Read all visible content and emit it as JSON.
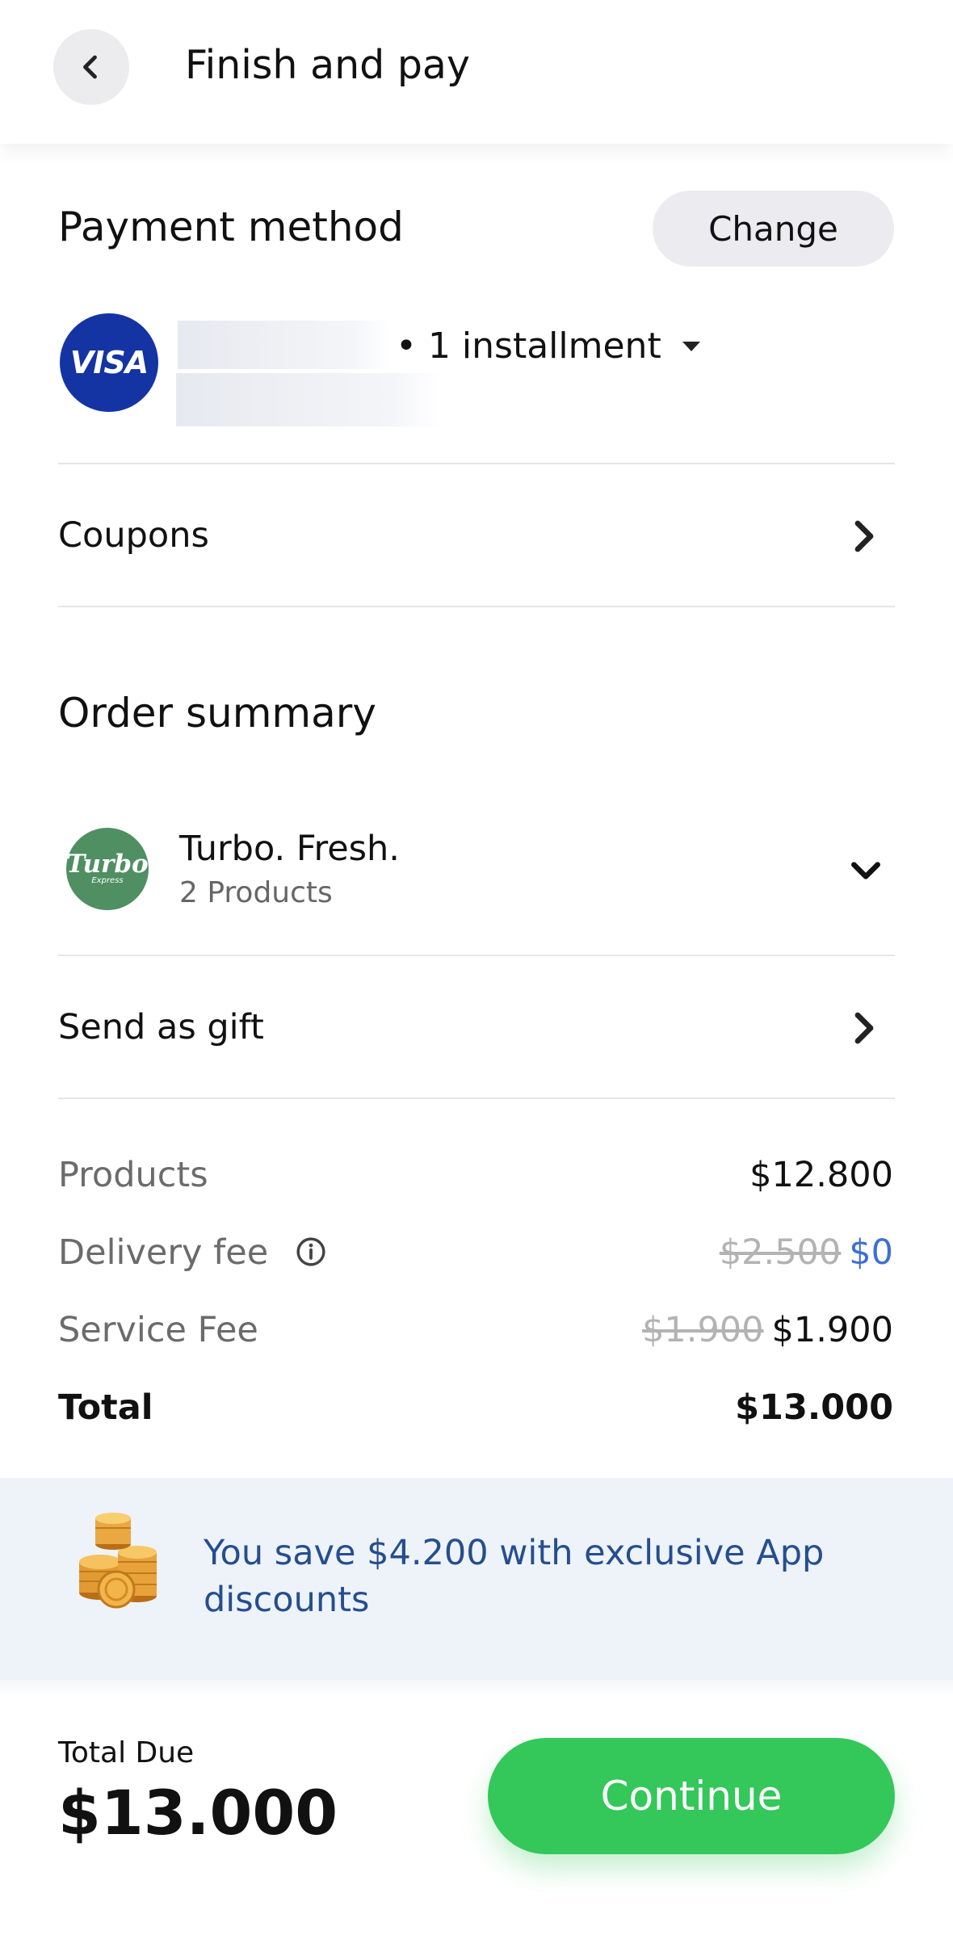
{
  "header": {
    "title": "Finish and pay"
  },
  "payment": {
    "title": "Payment method",
    "change_label": "Change",
    "card_brand": "VISA",
    "installment": "• 1 installment"
  },
  "coupons": {
    "label": "Coupons"
  },
  "order": {
    "title": "Order summary",
    "store": {
      "name": "Turbo. Fresh.",
      "products": "2 Products",
      "logo_text": "Turbo",
      "logo_subtext": "Express"
    }
  },
  "gift": {
    "label": "Send as gift"
  },
  "summary": {
    "products": {
      "label": "Products",
      "value": "$12.800"
    },
    "delivery": {
      "label": "Delivery fee",
      "old": "$2.500",
      "value": "$0"
    },
    "service": {
      "label": "Service Fee",
      "old": "$1.900",
      "value": "$1.900"
    },
    "total": {
      "label": "Total",
      "value": "$13.000"
    }
  },
  "savings": {
    "text": "You save $4.200 with exclusive App discounts"
  },
  "footer": {
    "total_due_label": "Total Due",
    "total_due_value": "$13.000",
    "continue_label": "Continue"
  },
  "colors": {
    "accent_green": "#34c759",
    "savings_blue": "#254e8f",
    "visa_blue": "#1434a4",
    "store_green": "#4f8f62"
  },
  "icons": [
    "chevron-left-icon",
    "caret-down-icon",
    "chevron-right-icon",
    "chevron-down-icon",
    "info-icon",
    "coins-icon"
  ]
}
